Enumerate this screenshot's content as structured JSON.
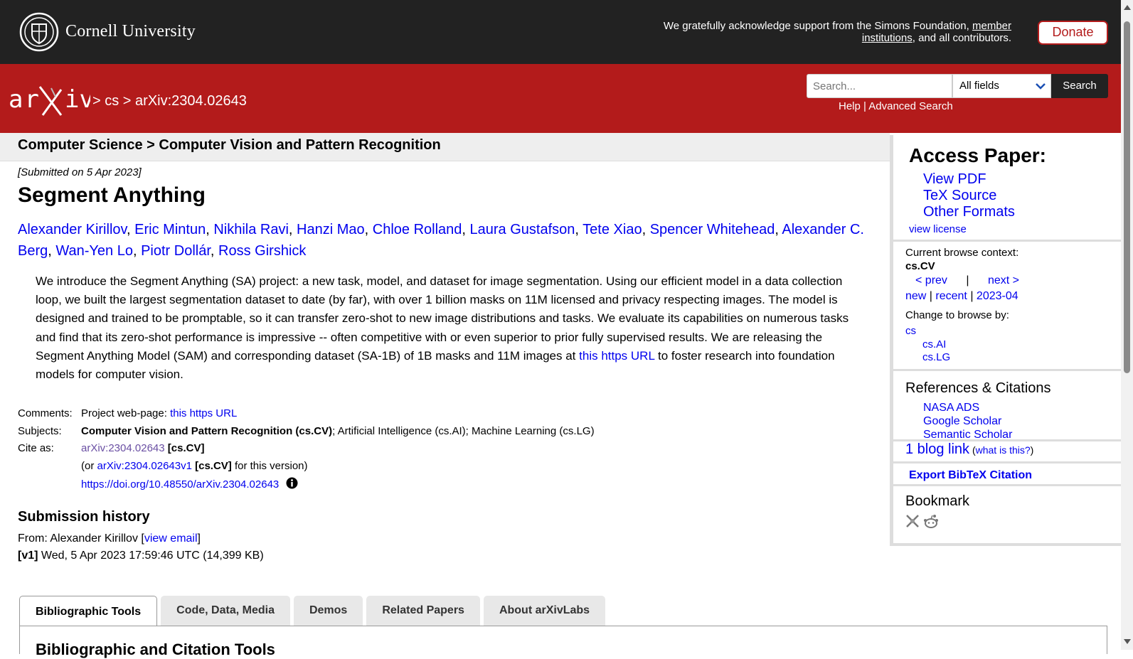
{
  "header": {
    "university": "Cornell University",
    "ack_text_1": "We gratefully acknowledge support from the Simons Foundation, ",
    "ack_link": "member institutions",
    "ack_text_2": ", and all contributors.",
    "donate_label": "Donate"
  },
  "nav": {
    "crumbs": "> cs > arXiv:2304.02643",
    "search_placeholder": "Search...",
    "field_select": "All fields",
    "search_button": "Search",
    "help": "Help",
    "separator": " | ",
    "advanced": "Advanced Search"
  },
  "paper": {
    "subject_header": "Computer Science > Computer Vision and Pattern Recognition",
    "submitted": "[Submitted on 5 Apr 2023]",
    "title": "Segment Anything",
    "authors": [
      "Alexander Kirillov",
      "Eric Mintun",
      "Nikhila Ravi",
      "Hanzi Mao",
      "Chloe Rolland",
      "Laura Gustafson",
      "Tete Xiao",
      "Spencer Whitehead",
      "Alexander C. Berg",
      "Wan-Yen Lo",
      "Piotr Dollár",
      "Ross Girshick"
    ],
    "abstract_1": "We introduce the Segment Anything (SA) project: a new task, model, and dataset for image segmentation. Using our efficient model in a data collection loop, we built the largest segmentation dataset to date (by far), with over 1 billion masks on 11M licensed and privacy respecting images. The model is designed and trained to be promptable, so it can transfer zero-shot to new image distributions and tasks. We evaluate its capabilities on numerous tasks and find that its zero-shot performance is impressive -- often competitive with or even superior to prior fully supervised results. We are releasing the Segment Anything Model (SAM) and corresponding dataset (SA-1B) of 1B masks and 11M images at ",
    "abstract_link": "this https URL",
    "abstract_2": " to foster research into foundation models for computer vision."
  },
  "meta": {
    "comments_label": "Comments:",
    "comments_text": "Project web-page: ",
    "comments_link": "this https URL",
    "subjects_label": "Subjects:",
    "subjects_primary": "Computer Vision and Pattern Recognition (cs.CV)",
    "subjects_rest": "; Artificial Intelligence (cs.AI); Machine Learning (cs.LG)",
    "cite_label": "Cite as:",
    "cite_link": "arXiv:2304.02643",
    "cite_tag": " [cs.CV]",
    "version_prefix": "(or ",
    "version_link": "arXiv:2304.02643v1",
    "version_tag": " [cs.CV]",
    "version_suffix": " for this version)",
    "doi": "https://doi.org/10.48550/arXiv.2304.02643"
  },
  "history": {
    "heading": "Submission history",
    "from_prefix": "From: Alexander Kirillov [",
    "view_email": "view email",
    "from_suffix": "]",
    "v1_label": "[v1]",
    "v1_text": " Wed, 5 Apr 2023 17:59:46 UTC (14,399 KB)"
  },
  "tabs": [
    "Bibliographic Tools",
    "Code, Data, Media",
    "Demos",
    "Related Papers",
    "About arXivLabs"
  ],
  "tab_panel_heading": "Bibliographic and Citation Tools",
  "sidebar": {
    "access_heading": "Access Paper:",
    "access_links": [
      "View PDF",
      "TeX Source",
      "Other Formats"
    ],
    "view_license": "view license",
    "context_label": "Current browse context:",
    "context_value": "cs.CV",
    "prev": "< prev",
    "nav_sep": "|",
    "next": "next >",
    "new": "new",
    "recent": "recent",
    "month": "2023-04",
    "pipe": " | ",
    "change_label": "Change to browse by:",
    "change_cs": "cs",
    "change_ai": "cs.AI",
    "change_lg": "cs.LG",
    "refs_heading": "References & Citations",
    "refs_links": [
      "NASA ADS",
      "Google Scholar",
      "Semantic Scholar"
    ],
    "blog_link": "1 blog link",
    "blog_open": " (",
    "blog_what": "what is this?",
    "blog_close": ")",
    "bibtex": "Export BibTeX Citation",
    "bookmark_heading": "Bookmark"
  },
  "icons": {
    "cornell": "cornell-seal-icon",
    "arxiv": "arxiv-logo-icon",
    "info": "info-icon",
    "bibsonomy": "bibsonomy-icon",
    "reddit": "reddit-icon"
  },
  "colors": {
    "arxiv_red": "#b31b1b",
    "top_bar": "#222222",
    "link": "#0000ee"
  }
}
